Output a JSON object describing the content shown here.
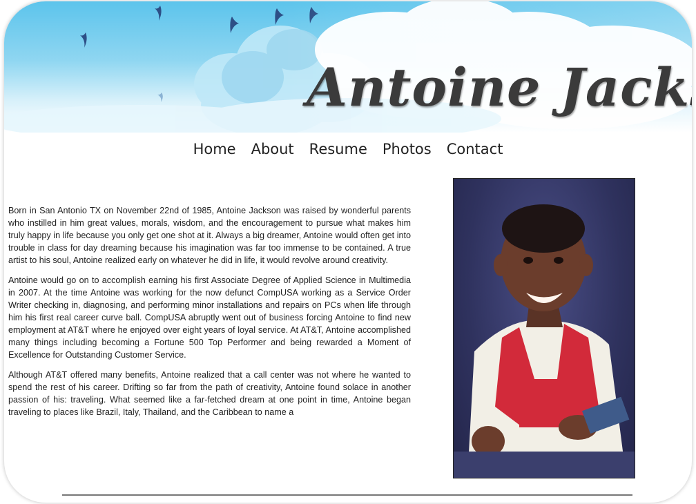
{
  "site": {
    "title": "Antoine Jackson"
  },
  "nav": [
    {
      "label": "Home"
    },
    {
      "label": "About"
    },
    {
      "label": "Resume"
    },
    {
      "label": "Photos"
    },
    {
      "label": "Contact"
    }
  ],
  "about": {
    "paragraphs": [
      "Born in San Antonio TX on November 22nd of 1985, Antoine Jackson was raised by wonderful parents who instilled in him great values, morals, wisdom, and the encouragement to pursue what makes him truly happy in life because you only get one shot at it. Always a big dreamer, Antoine would often get into trouble in class for day dreaming because his imagination was far too immense to be contained. A true artist to his soul, Antoine realized early on whatever he did in life, it would revolve around creativity.",
      "Antoine would go on to accomplish earning his first Associate Degree of Applied Science in Multimedia in 2007. At the time Antoine was working for the now defunct CompUSA working as a Service Order Writer checking in, diagnosing, and performing minor installations and repairs on PCs when life through him his first real career curve ball. CompUSA abruptly went out of business forcing Antoine to find new employment at AT&T where he enjoyed over eight years of loyal service. At AT&T, Antoine accomplished many things including becoming a Fortune 500 Top Performer and being rewarded a Moment of Excellence for Outstanding Customer Service.",
      "Although AT&T offered many benefits, Antoine realized that a call center was not where he wanted to spend the rest of his career. Drifting so far from the path of creativity, Antoine found solace in another passion of his: traveling. What seemed like a far-fetched dream at one point in time, Antoine began traveling to places like Brazil, Italy, Thailand, and the Caribbean to name a"
    ]
  },
  "colors": {
    "sky": "#5cc4ec",
    "cloud": "#ffffff",
    "text": "#222222",
    "photo_backdrop": "#2f325e",
    "shirt_red": "#d22a3a"
  },
  "icons": {
    "birds": "bird-silhouette",
    "clouds": "cloud-shape"
  }
}
